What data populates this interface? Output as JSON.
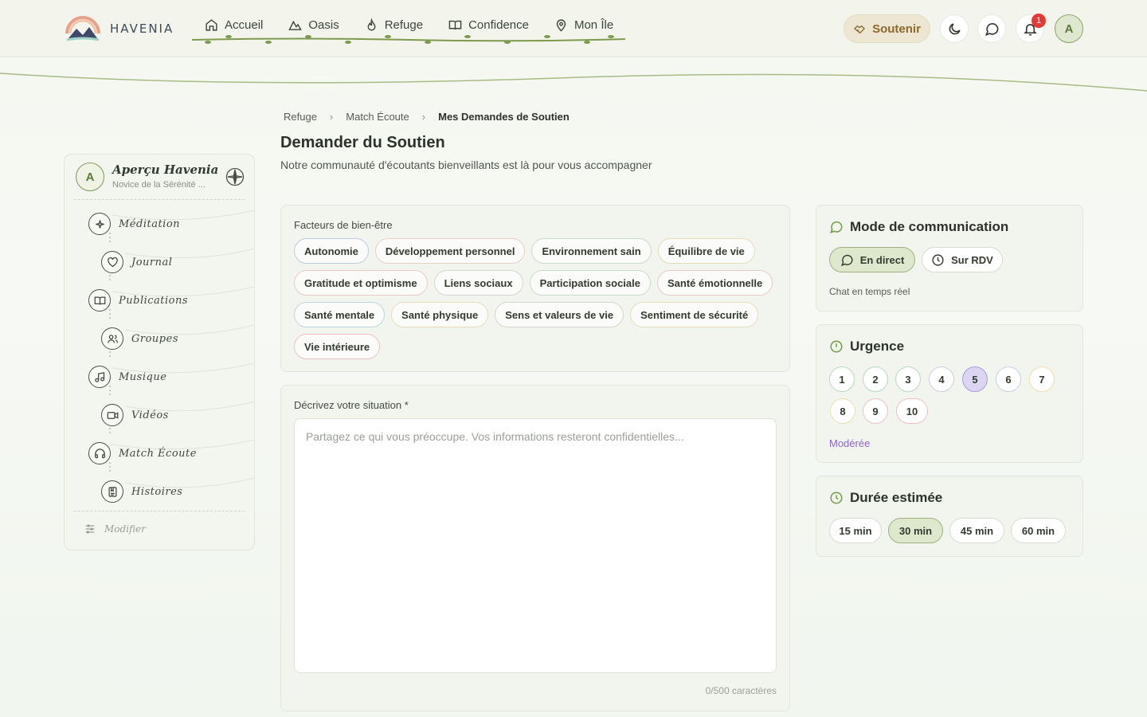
{
  "app": {
    "name": "HAVENIA"
  },
  "nav": {
    "items": [
      {
        "label": "Accueil",
        "icon": "home-icon"
      },
      {
        "label": "Oasis",
        "icon": "mountain-icon"
      },
      {
        "label": "Refuge",
        "icon": "flame-icon"
      },
      {
        "label": "Confidence",
        "icon": "book-icon"
      },
      {
        "label": "Mon Île",
        "icon": "map-pin-icon"
      }
    ]
  },
  "header": {
    "support_label": "Soutenir",
    "notification_count": "1",
    "avatar_initial": "A",
    "accent_color": "#8a6a2a"
  },
  "sidebar": {
    "avatar_initial": "A",
    "title": "Aperçu Havenia",
    "subtitle": "Novice de la Sérénité ...",
    "items": [
      {
        "label": "Méditation",
        "icon": "sparkles-icon"
      },
      {
        "label": "Journal",
        "icon": "heart-icon"
      },
      {
        "label": "Publications",
        "icon": "open-book-icon"
      },
      {
        "label": "Groupes",
        "icon": "users-icon"
      },
      {
        "label": "Musique",
        "icon": "music-icon"
      },
      {
        "label": "Vidéos",
        "icon": "video-icon"
      },
      {
        "label": "Match Écoute",
        "icon": "headphones-icon"
      },
      {
        "label": "Histoires",
        "icon": "book-bookmark-icon"
      }
    ],
    "modify_label": "Modifier"
  },
  "breadcrumb": [
    "Refuge",
    "Match Écoute",
    "Mes Demandes de Soutien"
  ],
  "page": {
    "title": "Demander du Soutien",
    "subtitle": "Notre communauté d'écoutants bienveillants est là pour vous accompagner"
  },
  "factors": {
    "label": "Facteurs de bien-être",
    "chips": [
      {
        "label": "Autonomie",
        "color": "#b9cde0"
      },
      {
        "label": "Développement personnel",
        "color": "#e8cfc2"
      },
      {
        "label": "Environnement sain",
        "color": "#c6ddc8"
      },
      {
        "label": "Équilibre de vie",
        "color": "#e6dcb9"
      },
      {
        "label": "Gratitude et optimisme",
        "color": "#ecc9c5"
      },
      {
        "label": "Liens sociaux",
        "color": "#d3d7cf"
      },
      {
        "label": "Participation sociale",
        "color": "#c6ddc8"
      },
      {
        "label": "Santé émotionnelle",
        "color": "#ecc9c5"
      },
      {
        "label": "Santé mentale",
        "color": "#bcd6e0"
      },
      {
        "label": "Santé physique",
        "color": "#e6dcb9"
      },
      {
        "label": "Sens et valeurs de vie",
        "color": "#d3d7cf"
      },
      {
        "label": "Sentiment de sécurité",
        "color": "#e6dcb9"
      },
      {
        "label": "Vie intérieure",
        "color": "#ecc0c4"
      }
    ]
  },
  "describe": {
    "label": "Décrivez votre situation *",
    "value": "",
    "placeholder": "Partagez ce qui vous préoccupe. Vos informations resteront confidentielles...",
    "counter": "0/500 caractères"
  },
  "mode": {
    "title": "Mode de communication",
    "options": [
      {
        "label": "En direct",
        "icon": "chat-icon",
        "selected": true
      },
      {
        "label": "Sur RDV",
        "icon": "clock-icon",
        "selected": false
      }
    ],
    "note": "Chat en temps réel"
  },
  "urgence": {
    "title": "Urgence",
    "levels": [
      {
        "label": "1",
        "color": "#b6d9c2"
      },
      {
        "label": "2",
        "color": "#b6d9c2"
      },
      {
        "label": "3",
        "color": "#b6d9c2"
      },
      {
        "label": "4",
        "color": "#c9cde6"
      },
      {
        "label": "5",
        "color": "#a99bd9"
      },
      {
        "label": "6",
        "color": "#c9cde6"
      },
      {
        "label": "7",
        "color": "#efdcae"
      },
      {
        "label": "8",
        "color": "#efdcae"
      },
      {
        "label": "9",
        "color": "#ecc0c4"
      },
      {
        "label": "10",
        "color": "#ecc0c4"
      }
    ],
    "selected": "5",
    "level_label": "Modérée"
  },
  "duree": {
    "title": "Durée estimée",
    "options": [
      {
        "label": "15 min",
        "selected": false
      },
      {
        "label": "30 min",
        "selected": true
      },
      {
        "label": "45 min",
        "selected": false
      },
      {
        "label": "60 min",
        "selected": false
      }
    ]
  }
}
